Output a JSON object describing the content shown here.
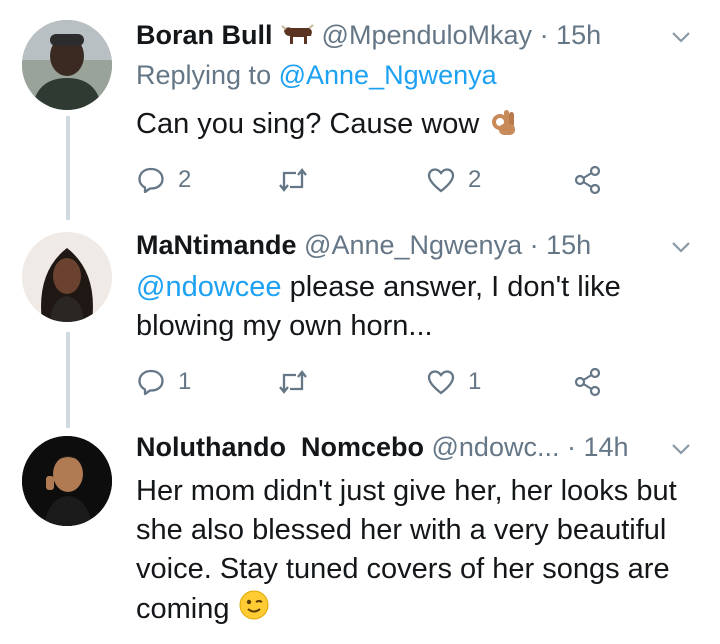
{
  "tweets": [
    {
      "name": "Boran Bull",
      "handle": "@MpenduloMkay",
      "time": "· 15h",
      "replying_prefix": "Replying to",
      "replying_to": "@Anne_Ngwenya",
      "text": "Can you sing? Cause wow",
      "replies": "2",
      "retweets": "",
      "likes": "2"
    },
    {
      "name": "MaNtimande",
      "handle": "@Anne_Ngwenya",
      "time": "· 15h",
      "mention": "@ndowcee",
      "text_line1": " please answer, I don't like",
      "text_line2": "blowing my own horn...",
      "replies": "1",
      "retweets": "",
      "likes": "1"
    },
    {
      "name": "Noluthando  Nomcebo",
      "handle": "@ndowc...",
      "time": "· 14h",
      "lines": [
        "Her mom didn't just give her, her looks but",
        "she also blessed her with a very beautiful",
        "voice. Stay tuned covers of her songs are",
        "coming"
      ]
    }
  ],
  "icons": {
    "emoji_1": "ok-hand-emoji",
    "emoji_2": "winking-face-emoji",
    "name_badge": "ox-emoji",
    "actions": [
      "reply-icon",
      "retweet-icon",
      "like-icon",
      "share-icon"
    ]
  },
  "colors": {
    "link": "#1da1f2",
    "secondary_text": "#657786",
    "thread_line": "#cfd9de"
  }
}
